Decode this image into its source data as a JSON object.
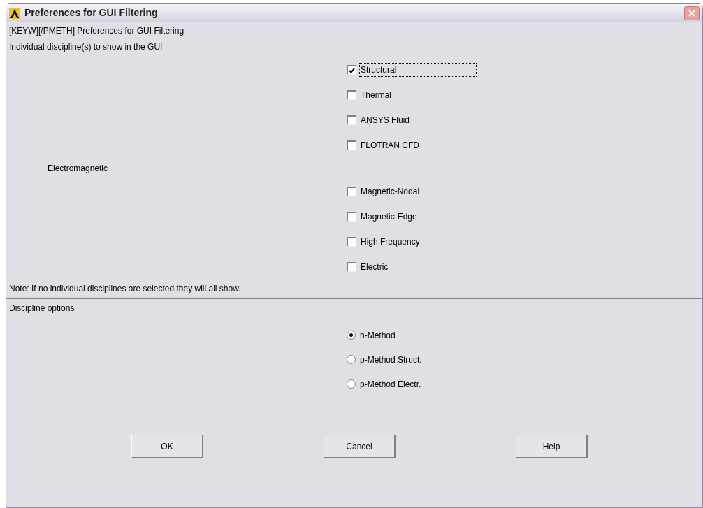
{
  "window": {
    "title": "Preferences for GUI Filtering"
  },
  "command_line": "[KEYW][/PMETH] Preferences for GUI Filtering",
  "disciplines_label": "Individual discipline(s) to show in the GUI",
  "disciplines": [
    {
      "label": "Structural",
      "checked": true,
      "focused": true
    },
    {
      "label": "Thermal",
      "checked": false,
      "focused": false
    },
    {
      "label": "ANSYS Fluid",
      "checked": false,
      "focused": false
    },
    {
      "label": "FLOTRAN CFD",
      "checked": false,
      "focused": false
    }
  ],
  "electromagnetic_label": "Electromagnetic",
  "electromagnetic_disciplines": [
    {
      "label": "Magnetic-Nodal",
      "checked": false,
      "focused": false
    },
    {
      "label": "Magnetic-Edge",
      "checked": false,
      "focused": false
    },
    {
      "label": "High Frequency",
      "checked": false,
      "focused": false
    },
    {
      "label": "Electric",
      "checked": false,
      "focused": false
    }
  ],
  "note": "Note: If no individual disciplines are selected they will all show.",
  "options_label": "Discipline options",
  "options": [
    {
      "label": "h-Method",
      "selected": true
    },
    {
      "label": "p-Method Struct.",
      "selected": false
    },
    {
      "label": "p-Method Electr.",
      "selected": false
    }
  ],
  "buttons": [
    "OK",
    "Cancel",
    "Help"
  ]
}
